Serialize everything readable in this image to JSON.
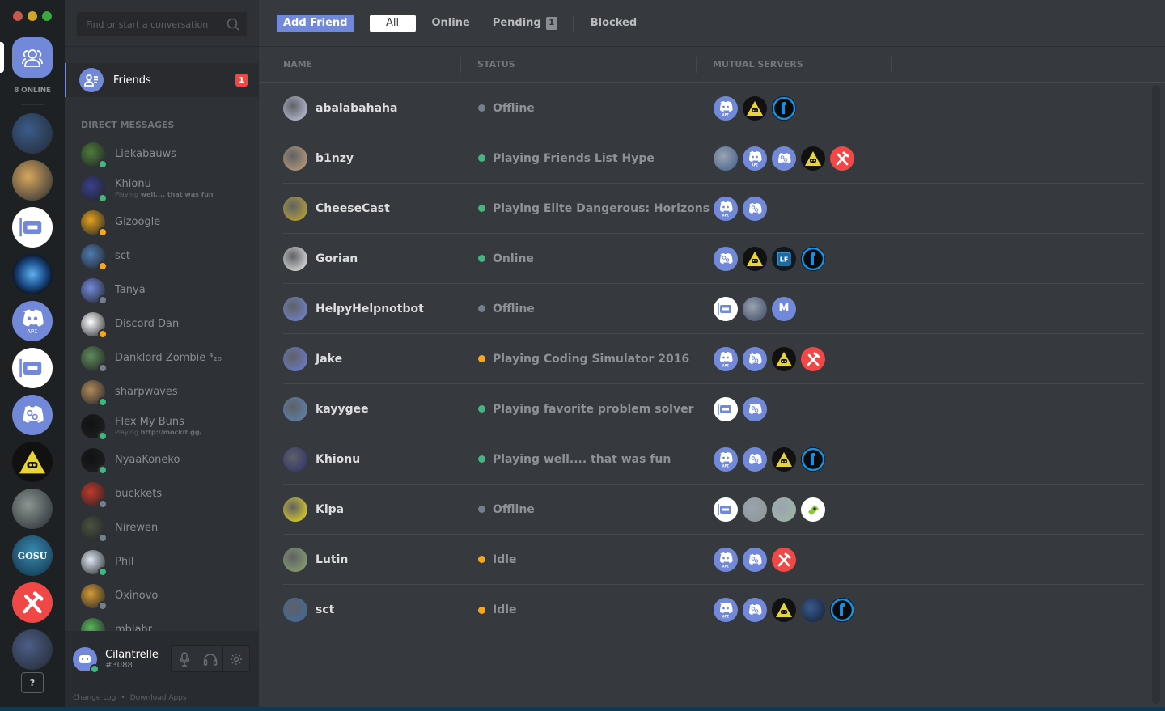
{
  "window": {
    "traffic_lights": [
      "close",
      "minimize",
      "maximize"
    ]
  },
  "guild_rail": {
    "online_count": "8 ONLINE",
    "guilds": [
      {
        "name": "hydra-server",
        "color": "#3b5c8a"
      },
      {
        "name": "rainbow-server",
        "color": "#d7a75d"
      },
      {
        "name": "discord-knight-server",
        "color": "#ffffff"
      },
      {
        "name": "heroes-server",
        "color": "#1a4b7c"
      },
      {
        "name": "discord-api-server",
        "color": "#7289da"
      },
      {
        "name": "discord-warrior-server",
        "color": "#ffffff"
      },
      {
        "name": "discord-gears-server",
        "color": "#7289da"
      },
      {
        "name": "illuminati-server",
        "color": "#111111"
      },
      {
        "name": "splatoon-server",
        "color": "#8c9590"
      },
      {
        "name": "gosu-server",
        "color": "#1c4e6b"
      },
      {
        "name": "hammer-server",
        "color": "#f04747"
      },
      {
        "name": "dragon-server",
        "color": "#4c5d86"
      }
    ],
    "help_label": "?"
  },
  "sidebar": {
    "search_placeholder": "Find or start a conversation",
    "friends_label": "Friends",
    "friends_badge": "1",
    "dm_header": "DIRECT MESSAGES",
    "dms": [
      {
        "name": "Liekabauws",
        "status": "online",
        "avatar_color": "#4d7c3a"
      },
      {
        "name": "Khionu",
        "status": "online",
        "avatar_color": "#3a3f8a",
        "sub_prefix": "Playing ",
        "sub_game": "well.... that was fun"
      },
      {
        "name": "Gizoogle",
        "status": "idle",
        "avatar_color": "#e5a21e"
      },
      {
        "name": "sct",
        "status": "idle",
        "avatar_color": "#4f7bb0"
      },
      {
        "name": "Tanya",
        "status": "offline",
        "avatar_color": "#7289da"
      },
      {
        "name": "Discord Dan",
        "status": "idle",
        "avatar_color": "#ffffff"
      },
      {
        "name": "Danklord Zombie ⁴₂₀",
        "status": "offline",
        "avatar_color": "#5f8a5a"
      },
      {
        "name": "sharpwaves",
        "status": "online",
        "avatar_color": "#b08a5a"
      },
      {
        "name": "Flex My Buns",
        "status": "online",
        "avatar_color": "#111111",
        "sub_prefix": "Playing ",
        "sub_game": "http://mockit.gg/"
      },
      {
        "name": "NyaaKoneko",
        "status": "online",
        "avatar_color": "#111111"
      },
      {
        "name": "buckkets",
        "status": "offline",
        "avatar_color": "#c0392b"
      },
      {
        "name": "Nirewen",
        "status": "offline",
        "avatar_color": "#4a5340"
      },
      {
        "name": "Phil",
        "status": "online",
        "avatar_color": "#dfe8f2"
      },
      {
        "name": "Oxinovo",
        "status": "offline",
        "avatar_color": "#d49a36"
      },
      {
        "name": "mblahr",
        "status": "online",
        "avatar_color": "#5ab45a"
      }
    ]
  },
  "user_panel": {
    "username": "Cilantrelle",
    "discriminator": "#3088",
    "status": "online",
    "buttons": [
      "microphone",
      "headphones",
      "settings"
    ]
  },
  "footer": {
    "change_log": "Change Log",
    "bullet": "•",
    "download_apps": "Download Apps"
  },
  "topbar": {
    "add_friend": "Add Friend",
    "tabs": [
      {
        "label": "All",
        "active": true
      },
      {
        "label": "Online",
        "active": false
      },
      {
        "label": "Pending",
        "active": false,
        "badge": "1"
      },
      {
        "label": "Blocked",
        "active": false
      }
    ]
  },
  "table": {
    "columns": [
      "NAME",
      "STATUS",
      "MUTUAL SERVERS"
    ],
    "rows": [
      {
        "name": "abalabahaha",
        "status": "offline",
        "status_text": "Offline",
        "avatar_color": "#c9cde8",
        "servers": [
          "api",
          "illuminati",
          "wrench"
        ]
      },
      {
        "name": "b1nzy",
        "status": "online",
        "status_text": "Playing Friends List Hype",
        "avatar_color": "#c9a37a",
        "servers": [
          "hydra",
          "api",
          "gears",
          "illuminati",
          "hammer"
        ]
      },
      {
        "name": "CheeseCast",
        "status": "online",
        "status_text": "Playing Elite Dangerous: Horizons",
        "avatar_color": "#c8ac2e",
        "servers": [
          "api",
          "gears"
        ]
      },
      {
        "name": "Gorian",
        "status": "online",
        "status_text": "Online",
        "avatar_color": "#f2f2f2",
        "servers": [
          "gears",
          "illuminati",
          "lf-chip",
          "wrench"
        ]
      },
      {
        "name": "HelpyHelpnotbot",
        "status": "offline",
        "status_text": "Offline",
        "avatar_color": "#7289da",
        "servers": [
          "knight",
          "dragon",
          "m-letter"
        ]
      },
      {
        "name": "Jake",
        "status": "idle",
        "status_text": "Playing Coding Simulator 2016",
        "avatar_color": "#6d7ed8",
        "servers": [
          "api",
          "gears",
          "illuminati",
          "hammer"
        ]
      },
      {
        "name": "kayygee",
        "status": "online",
        "status_text": "Playing favorite problem solver",
        "avatar_color": "#5b86b8",
        "servers": [
          "warrior",
          "gears"
        ]
      },
      {
        "name": "Khionu",
        "status": "online",
        "status_text": "Playing well.... that was fun",
        "avatar_color": "#2b2f6e",
        "servers": [
          "api",
          "gears",
          "illuminati",
          "wrench"
        ]
      },
      {
        "name": "Kipa",
        "status": "offline",
        "status_text": "Offline",
        "avatar_color": "#f2e21a",
        "servers": [
          "knight",
          "splatoon",
          "map",
          "squid"
        ]
      },
      {
        "name": "Lutin",
        "status": "idle",
        "status_text": "Idle",
        "avatar_color": "#8fa96e",
        "servers": [
          "api",
          "gears",
          "hammer"
        ]
      },
      {
        "name": "sct",
        "status": "idle",
        "status_text": "Idle",
        "avatar_color": "#3d6aa0",
        "servers": [
          "api",
          "gears",
          "illuminati",
          "screenshot",
          "wrench"
        ]
      }
    ]
  },
  "status_colors": {
    "online": "#43b581",
    "idle": "#faa61a",
    "offline": "#747f8d"
  },
  "server_icons": {
    "api": {
      "bg": "#7289da",
      "glyph": "discord-api"
    },
    "gears": {
      "bg": "#7289da",
      "glyph": "discord-gears"
    },
    "illuminati": {
      "bg": "#111111",
      "glyph": "yellow-triangle"
    },
    "wrench": {
      "bg": "#0b0b0b",
      "glyph": "blue-wrench"
    },
    "hydra": {
      "bg": "#3b5c8a",
      "glyph": "image"
    },
    "hammer": {
      "bg": "#f04747",
      "glyph": "crossed-hammers"
    },
    "lf-chip": {
      "bg": "#101820",
      "glyph": "LF"
    },
    "knight": {
      "bg": "#ffffff",
      "glyph": "discord-knight"
    },
    "dragon": {
      "bg": "#3a4560",
      "glyph": "image"
    },
    "m-letter": {
      "bg": "#7289da",
      "glyph": "M"
    },
    "warrior": {
      "bg": "#ffffff",
      "glyph": "discord-warrior"
    },
    "splatoon": {
      "bg": "#8c9590",
      "glyph": "image"
    },
    "map": {
      "bg": "#9fb8a4",
      "glyph": "image"
    },
    "squid": {
      "bg": "#ffffff",
      "glyph": "green-squid"
    },
    "screenshot": {
      "bg": "#0f1d33",
      "glyph": "image"
    }
  }
}
